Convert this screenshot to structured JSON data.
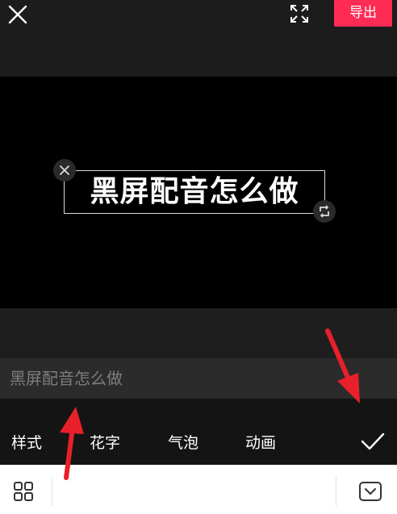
{
  "header": {
    "export_label": "导出",
    "close_icon": "close-icon",
    "fullscreen_icon": "fullscreen-icon"
  },
  "canvas": {
    "overlay_text": "黑屏配音怎么做",
    "background_color": "#000000"
  },
  "editor": {
    "input_value": "黑屏配音怎么做"
  },
  "tabs": [
    {
      "label": "样式"
    },
    {
      "label": "花字"
    },
    {
      "label": "气泡"
    },
    {
      "label": "动画"
    }
  ],
  "colors": {
    "accent": "#fe2c55",
    "annotation_arrow": "#e8202a"
  }
}
